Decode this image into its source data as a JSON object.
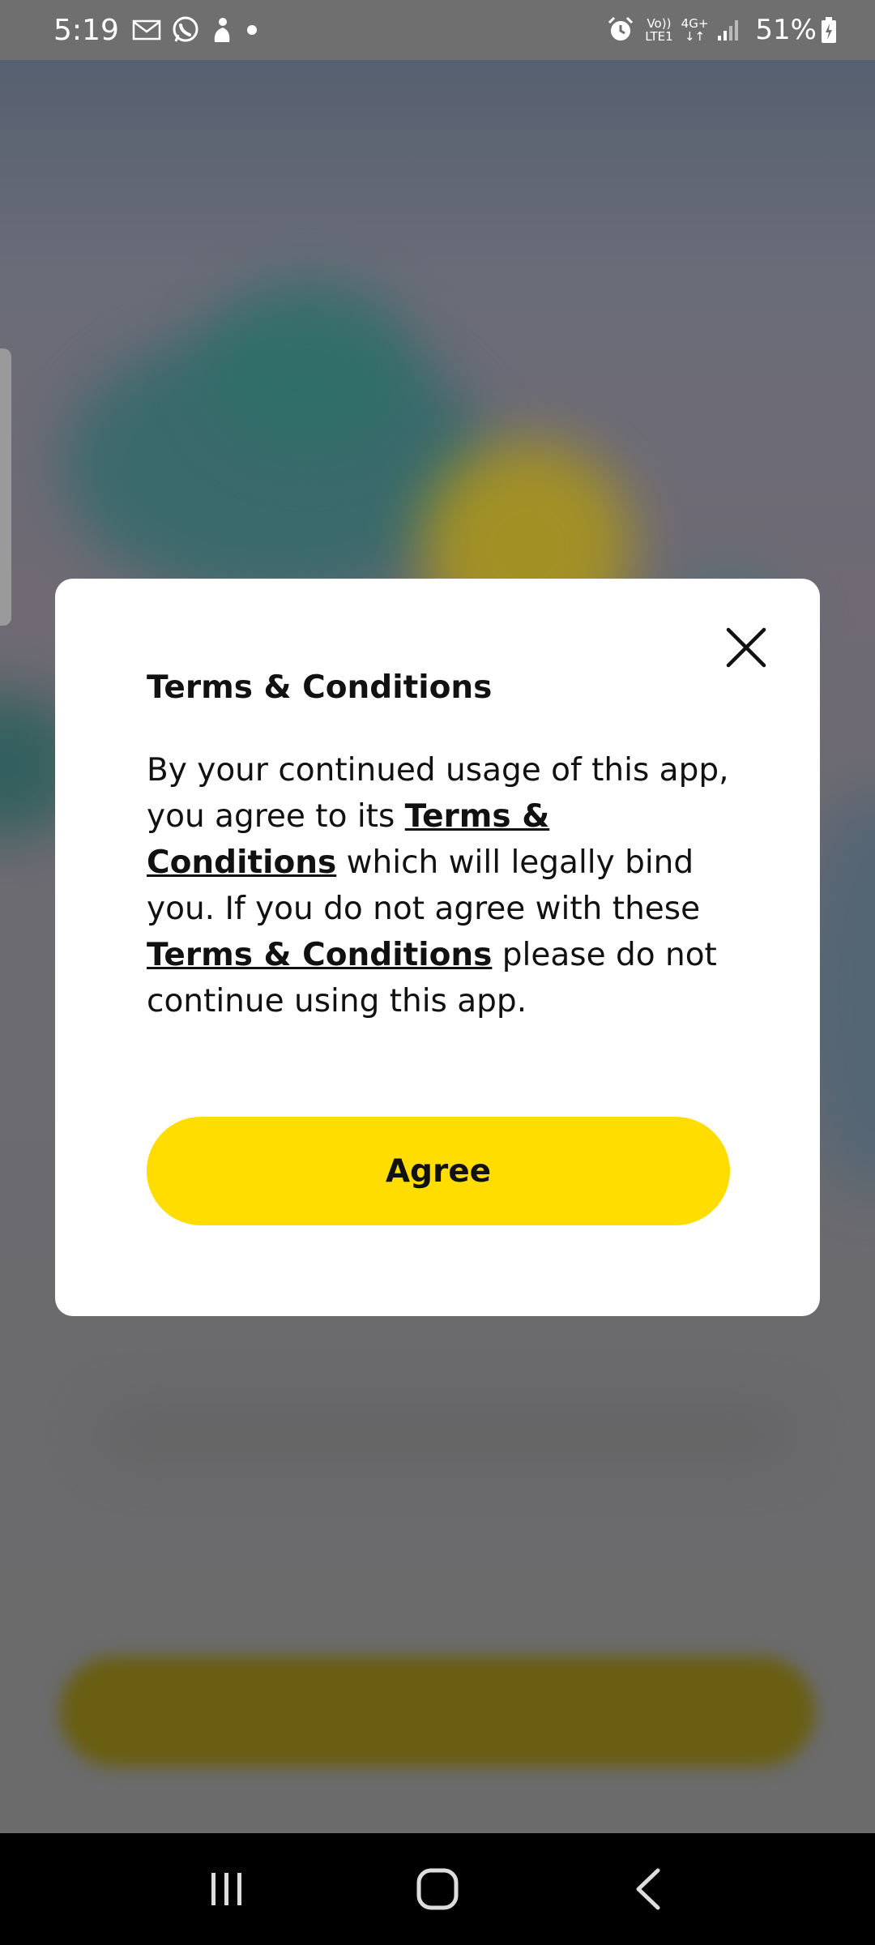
{
  "status_bar": {
    "time": "5:19",
    "network_volte": "Vo))",
    "network_lte": "LTE1",
    "network_4g": "4G+",
    "battery": "51%",
    "icons": [
      "mail-icon",
      "whatsapp-icon",
      "app-notification-icon",
      "dot-icon",
      "alarm-icon",
      "signal-icon",
      "battery-charging-icon"
    ]
  },
  "dialog": {
    "title": "Terms & Conditions",
    "body_part1": "By your continued usage of this app, you agree to its ",
    "link1": "Terms & Conditions",
    "body_part2": " which will legally bind you. If you do not agree with these ",
    "link2": "Terms & Conditions",
    "body_part3": " please do not continue using this app.",
    "agree_label": "Agree",
    "close_icon": "close-icon"
  },
  "colors": {
    "accent": "#ffdd00",
    "dialog_bg": "#ffffff",
    "scrim": "#6b6b6b",
    "nav_bar": "#000000"
  },
  "nav_bar": {
    "icons": [
      "recent-apps-icon",
      "home-icon",
      "back-icon"
    ]
  }
}
